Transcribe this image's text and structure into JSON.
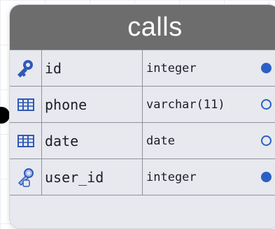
{
  "table": {
    "title": "calls",
    "columns": [
      {
        "name": "id",
        "type": "integer",
        "icon": "primary-key-icon",
        "required": true
      },
      {
        "name": "phone",
        "type": "varchar(11)",
        "icon": "column-grid-icon",
        "required": false
      },
      {
        "name": "date",
        "type": "date",
        "icon": "column-grid-icon",
        "required": false
      },
      {
        "name": "user_id",
        "type": "integer",
        "icon": "foreign-key-icon",
        "required": true
      }
    ]
  },
  "colors": {
    "header_bg": "#6d6d6d",
    "card_bg": "#e7e9ef",
    "accent_blue": "#2b5fc6",
    "connector": "#000000"
  }
}
